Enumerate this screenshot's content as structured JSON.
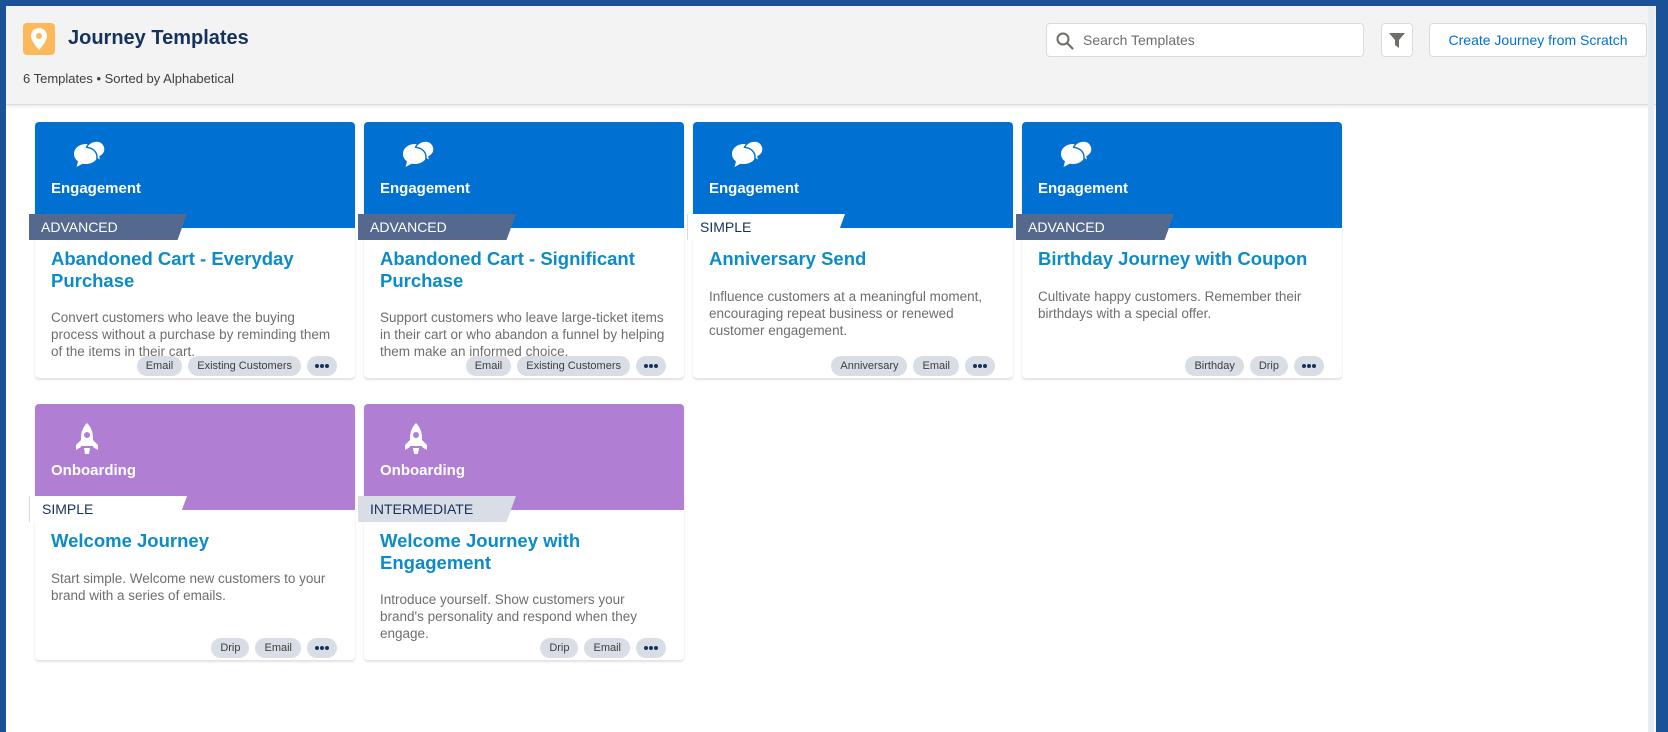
{
  "header": {
    "title": "Journey Templates",
    "subtitle": "6 Templates • Sorted by Alphabetical",
    "search_placeholder": "Search Templates",
    "create_label": "Create Journey from Scratch"
  },
  "colors": {
    "engagement": "#0070d2",
    "onboarding": "#b07fd3",
    "advanced_badge": "#54698d",
    "title_link": "#0b8cc8",
    "app_icon": "#fcb95b"
  },
  "cards": [
    {
      "category": "Engagement",
      "icon": "chat-bubbles-icon",
      "level": "ADVANCED",
      "title": "Abandoned Cart - Everyday Purchase",
      "description": "Convert customers who leave the buying process without a purchase by reminding them of the items in their cart.",
      "tags": [
        "Email",
        "Existing Customers"
      ]
    },
    {
      "category": "Engagement",
      "icon": "chat-bubbles-icon",
      "level": "ADVANCED",
      "title": "Abandoned Cart - Significant Purchase",
      "description": "Support customers who leave large-ticket items in their cart or who abandon a funnel by helping them make an informed choice.",
      "tags": [
        "Email",
        "Existing Customers"
      ]
    },
    {
      "category": "Engagement",
      "icon": "chat-bubbles-icon",
      "level": "SIMPLE",
      "title": "Anniversary Send",
      "description": "Influence customers at a meaningful moment, encouraging repeat business or renewed customer engagement.",
      "tags": [
        "Anniversary",
        "Email"
      ]
    },
    {
      "category": "Engagement",
      "icon": "chat-bubbles-icon",
      "level": "ADVANCED",
      "title": "Birthday Journey with Coupon",
      "description": "Cultivate happy customers. Remember their birthdays with a special offer.",
      "tags": [
        "Birthday",
        "Drip"
      ]
    },
    {
      "category": "Onboarding",
      "icon": "rocket-icon",
      "level": "SIMPLE",
      "title": "Welcome Journey",
      "description": "Start simple. Welcome new customers to your brand with a series of emails.",
      "tags": [
        "Drip",
        "Email"
      ]
    },
    {
      "category": "Onboarding",
      "icon": "rocket-icon",
      "level": "INTERMEDIATE",
      "title": "Welcome Journey with Engagement",
      "description": "Introduce yourself. Show customers your brand's personality and respond when they engage.",
      "tags": [
        "Drip",
        "Email"
      ]
    }
  ]
}
